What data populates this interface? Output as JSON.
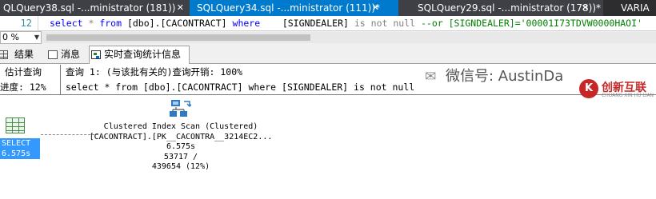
{
  "document_tabs": [
    {
      "label": "QLQuery38.sql -...ministrator (181))",
      "close": "✕",
      "active": false
    },
    {
      "label": "SQLQuery34.sql -...ministrator (111))*",
      "close": "✕",
      "active": true
    },
    {
      "label": "SQLQuery29.sql -...ministrator (178))*",
      "close": "✕",
      "active": false
    },
    {
      "label": "VARIA",
      "active": false
    }
  ],
  "editor": {
    "line_number": "12",
    "code": {
      "select": "select",
      "star": " * ",
      "from": "from",
      "table": " [dbo].[CACONTRACT] ",
      "where": "where",
      "column": "    [SIGNDEALER] ",
      "is": "is",
      "not": "not",
      "null": "null",
      "comment": "--or [SIGNDEALER]='00001I73TDVW0000HAOI'"
    }
  },
  "zoom": {
    "value": "0 %"
  },
  "result_tabs": {
    "results": "结果",
    "messages": "消息",
    "live_stats": "实时查询统计信息"
  },
  "query_info": {
    "left_line1": "估计查询",
    "left_line2": "进度: 12%",
    "right_line1": "查询 1: (与该批有关的)查询开销: 100%",
    "right_line2": "select * from [dbo].[CACONTRACT] where [SIGNDEALER] is not null"
  },
  "plan": {
    "select_node": {
      "line1": "SELECT",
      "line2": "6.575s"
    },
    "scan_node": {
      "line1": "Clustered Index Scan (Clustered)",
      "line2": "[CACONTRACT].[PK__CACONTRA__3214EC2...",
      "line3": "6.575s",
      "line4": "53717 /",
      "line5": "439654 (12%)"
    }
  },
  "watermark": {
    "text": "微信号: AustinDa"
  },
  "brand": {
    "name": "创新互联",
    "sub": "CHUANG XIN HU LIAN",
    "mark": "K"
  },
  "colors": {
    "active_tab": "#007acc",
    "selection": "#3399ff",
    "keyword": "#0000ff",
    "comment": "#008000"
  }
}
